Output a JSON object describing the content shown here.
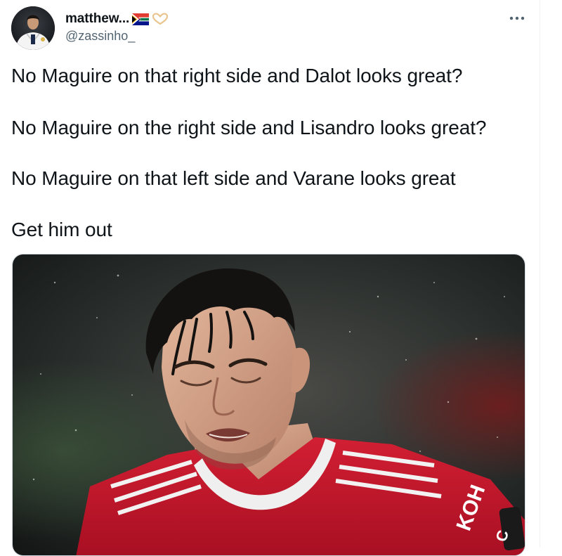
{
  "author": {
    "display_name": "matthew...",
    "handle": "@zassinho_",
    "flag_icon": "south-africa-flag-emoji",
    "extra_icon": "heart-hands-emoji"
  },
  "tweet": {
    "lines": [
      "No Maguire on that right side and Dalot looks great?",
      "No Maguire on the right side and Lisandro looks great?",
      "No Maguire on that left side and Varane looks great",
      "Get him out"
    ]
  },
  "media": {
    "shirt_text": "KOH",
    "badge_text": "C"
  },
  "colors": {
    "text": "#0f1419",
    "secondary": "#536471",
    "shirt_red": "#c8102e",
    "shirt_stripe": "#f2f2f2"
  }
}
